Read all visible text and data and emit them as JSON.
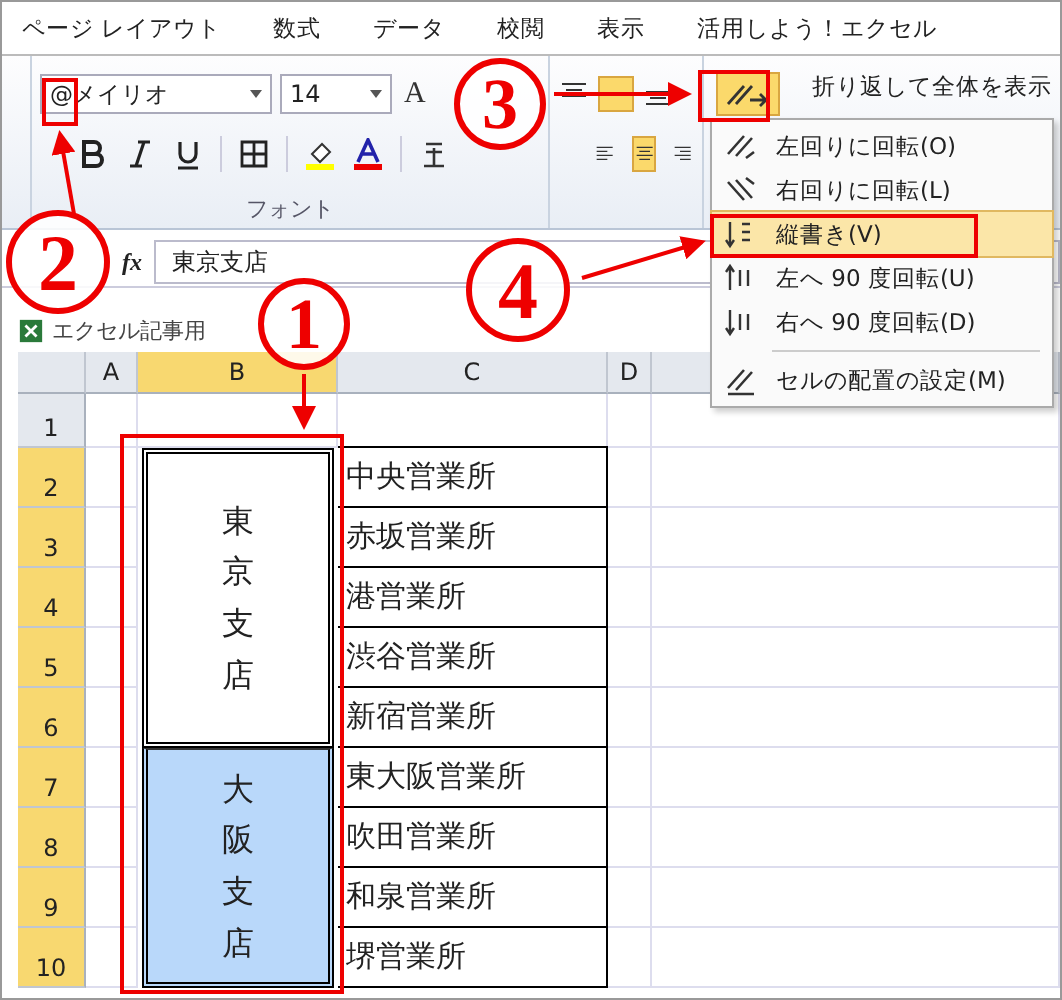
{
  "menu_tabs": [
    {
      "label": "ページ レイアウト",
      "selected": false
    },
    {
      "label": "数式",
      "selected": false
    },
    {
      "label": "データ",
      "selected": false
    },
    {
      "label": "校閲",
      "selected": false
    },
    {
      "label": "表示",
      "selected": false
    },
    {
      "label": "活用しよう！エクセル",
      "selected": false
    }
  ],
  "font": {
    "name": "@メイリオ",
    "size": "14",
    "grow_label": "A",
    "group_label": "フォント"
  },
  "orientation_button": {
    "selected": true
  },
  "wrap_text": "折り返して全体を表示",
  "orientation_menu": [
    {
      "label": "左回りに回転(O)",
      "selected": false,
      "kind": "ccw"
    },
    {
      "label": "右回りに回転(L)",
      "selected": false,
      "kind": "cw"
    },
    {
      "label": "縦書き(V)",
      "selected": true,
      "kind": "vertical"
    },
    {
      "label": "左へ 90 度回転(U)",
      "selected": false,
      "kind": "up"
    },
    {
      "label": "右へ 90 度回転(D)",
      "selected": false,
      "kind": "down"
    },
    {
      "label": "セルの配置の設定(M)",
      "selected": false,
      "kind": "settings"
    }
  ],
  "formula_bar": {
    "function_label": "fx",
    "value": "東京支店"
  },
  "workbook_title": "エクセル記事用",
  "sheet": {
    "columns": [
      "A",
      "B",
      "C",
      "D"
    ],
    "row_numbers": [
      "1",
      "2",
      "3",
      "4",
      "5",
      "6",
      "7",
      "8",
      "9",
      "10"
    ],
    "merged_cells": [
      {
        "text": "東京支店",
        "selected": false
      },
      {
        "text": "大阪支店",
        "selected": true
      }
    ],
    "column_c": [
      "中央営業所",
      "赤坂営業所",
      "港営業所",
      "渋谷営業所",
      "新宿営業所",
      "東大阪営業所",
      "吹田営業所",
      "和泉営業所",
      "堺営業所"
    ]
  },
  "annotations": [
    "3",
    "2",
    "1",
    "4"
  ]
}
